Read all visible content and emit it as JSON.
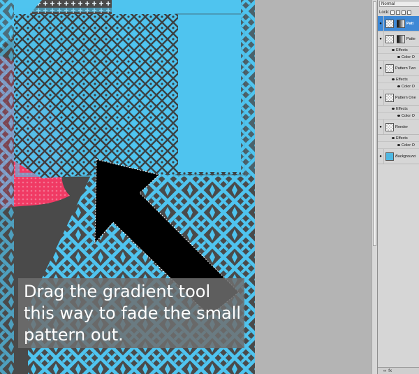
{
  "canvas": {
    "colors": {
      "dark": "#4a4a4a",
      "blue": "#4fc4ef",
      "pink": "#f03a64",
      "pattern_dark": "#3a3a3a",
      "white_cross": "#e9f4fa"
    },
    "callout_text": "Drag the gradient tool this way to fade the small pattern out.",
    "arrow_icon": "arrow-up-left-icon"
  },
  "layers_panel": {
    "blend_mode": "Normal",
    "lock_label": "Lock:",
    "layers": [
      {
        "name": "Patt",
        "selected": true,
        "thumb": "checker",
        "has_mask": true,
        "sub": []
      },
      {
        "name": "Patte",
        "selected": false,
        "thumb": "checker",
        "has_mask": true,
        "sub": [
          "Effects",
          "Color O"
        ]
      },
      {
        "name": "Pattern Two",
        "selected": false,
        "thumb": "checker",
        "has_mask": false,
        "sub": [
          "Effects",
          "Color O"
        ]
      },
      {
        "name": "Pattern One",
        "selected": false,
        "thumb": "checker",
        "has_mask": false,
        "sub": [
          "Effects",
          "Color O"
        ]
      },
      {
        "name": "Render",
        "selected": false,
        "thumb": "checker",
        "has_mask": false,
        "sub": [
          "Effects",
          "Color O"
        ]
      },
      {
        "name": "Background",
        "selected": false,
        "thumb": "blue",
        "has_mask": false,
        "italic": true,
        "sub": []
      }
    ],
    "bottom_icons": [
      "link-icon",
      "fx-icon"
    ],
    "bottom_glyphs": [
      "∞",
      "fx"
    ]
  }
}
